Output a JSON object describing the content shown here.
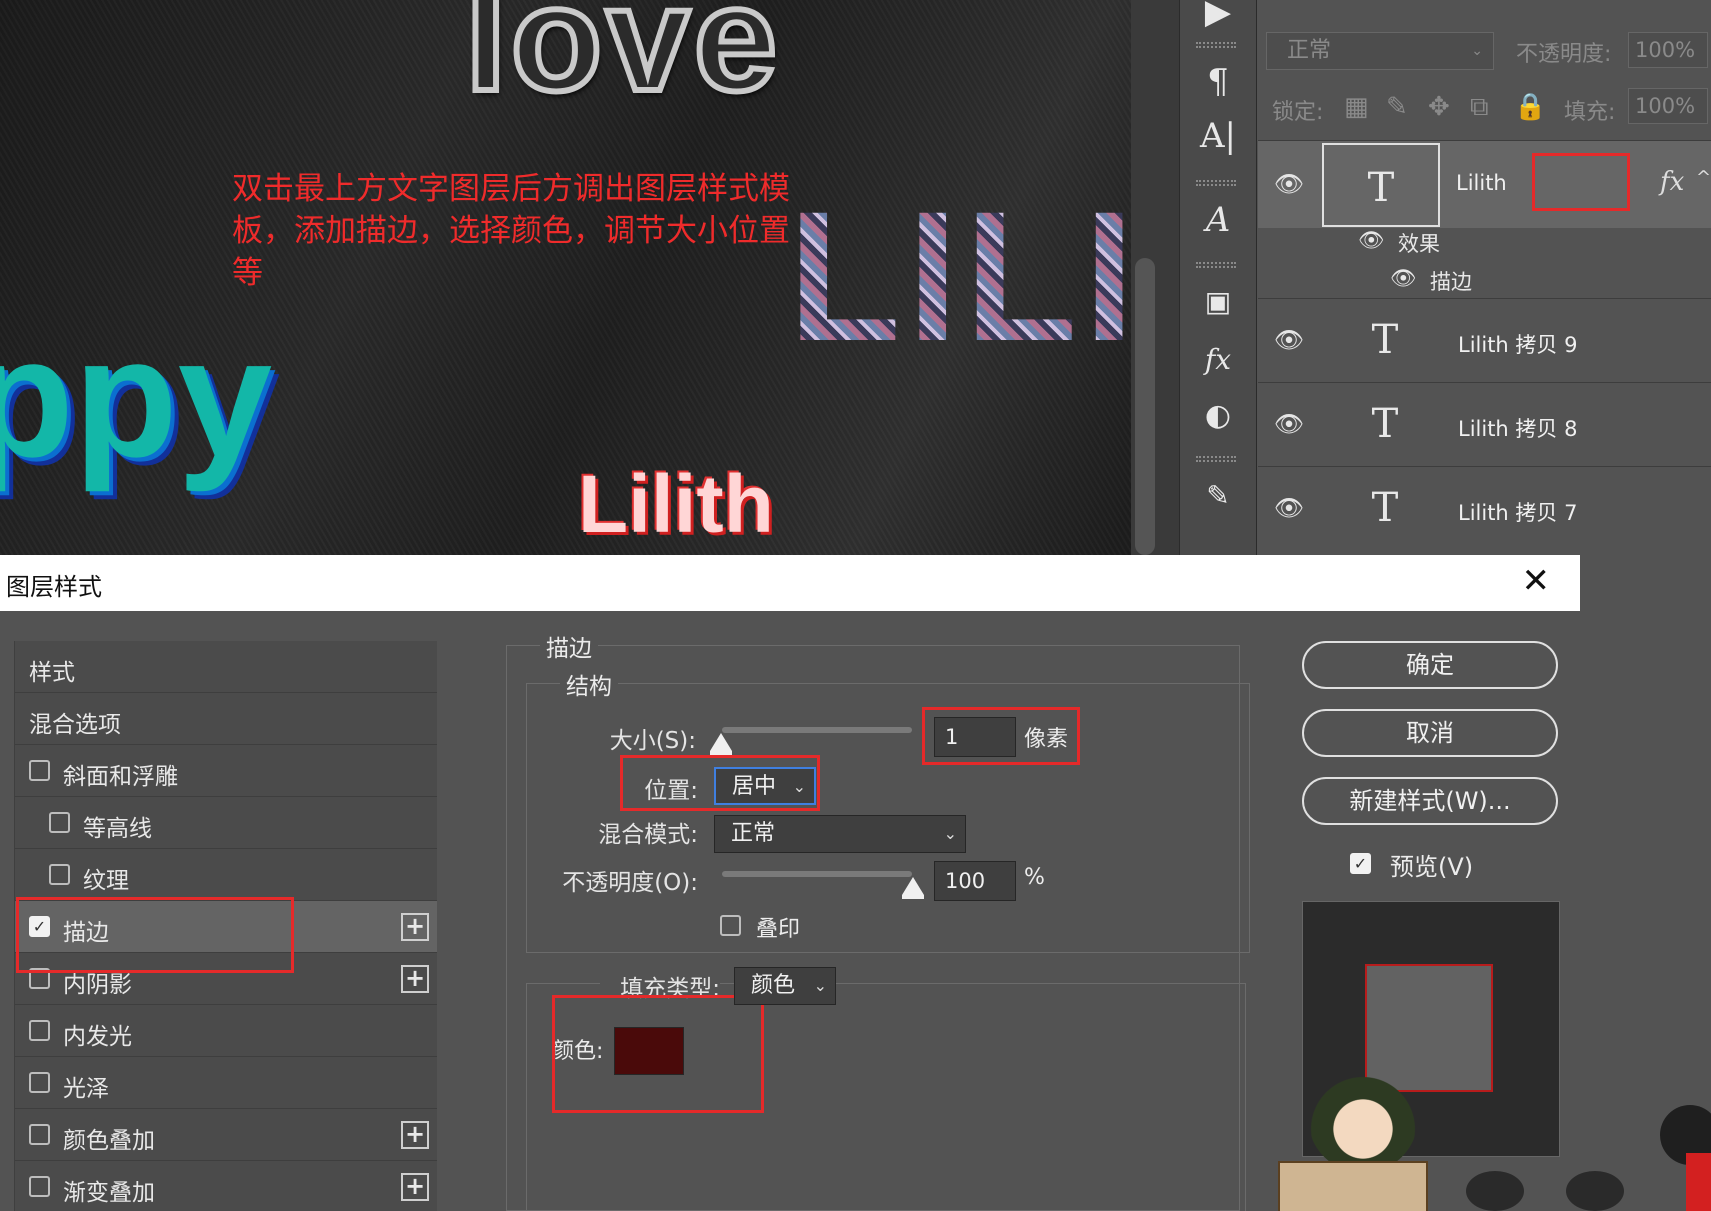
{
  "canvas": {
    "art_love": "love",
    "art_ppy": "ppy",
    "art_lili": "LILI",
    "art_lilith": "Lilith",
    "annotation": "双击最上方文字图层后方调出图层样式模板，添加描边，选择颜色，调节大小位置等"
  },
  "layers_panel": {
    "blend_mode": "正常",
    "opacity_label": "不透明度:",
    "opacity_value": "100%",
    "lock_label": "锁定:",
    "fill_label": "填充:",
    "fill_value": "100%",
    "layers": [
      {
        "name": "Lilith",
        "type": "T",
        "fx": "fx",
        "active": true
      },
      {
        "name": "Lilith 拷贝 9",
        "type": "T"
      },
      {
        "name": "Lilith 拷贝 8",
        "type": "T"
      },
      {
        "name": "Lilith 拷贝 7",
        "type": "T"
      }
    ],
    "effects_label": "效果",
    "stroke_effect_label": "描边"
  },
  "dialog": {
    "title": "图层样式",
    "left_list": {
      "styles": "样式",
      "blending": "混合选项",
      "bevel": "斜面和浮雕",
      "contour": "等高线",
      "texture": "纹理",
      "stroke": "描边",
      "inner_shadow": "内阴影",
      "inner_glow": "内发光",
      "satin": "光泽",
      "color_overlay": "颜色叠加",
      "gradient_overlay": "渐变叠加"
    },
    "stroke_group_title": "描边",
    "structure_title": "结构",
    "size_label": "大小(S):",
    "size_value": "1",
    "size_unit": "像素",
    "position_label": "位置:",
    "position_value": "居中",
    "blend_label": "混合模式:",
    "blend_value": "正常",
    "opacity_label": "不透明度(O):",
    "opacity_value": "100",
    "opacity_unit": "%",
    "overprint_label": "叠印",
    "fill_type_label": "填充类型:",
    "fill_type_value": "颜色",
    "color_label": "颜色:",
    "stroke_color": "#4a0a0a",
    "buttons": {
      "ok": "确定",
      "cancel": "取消",
      "new_style": "新建样式(W)...",
      "preview": "预览(V)"
    }
  },
  "colors": {
    "annotation_red": "#ef2b2b",
    "highlight_box": "#e52a2a"
  }
}
